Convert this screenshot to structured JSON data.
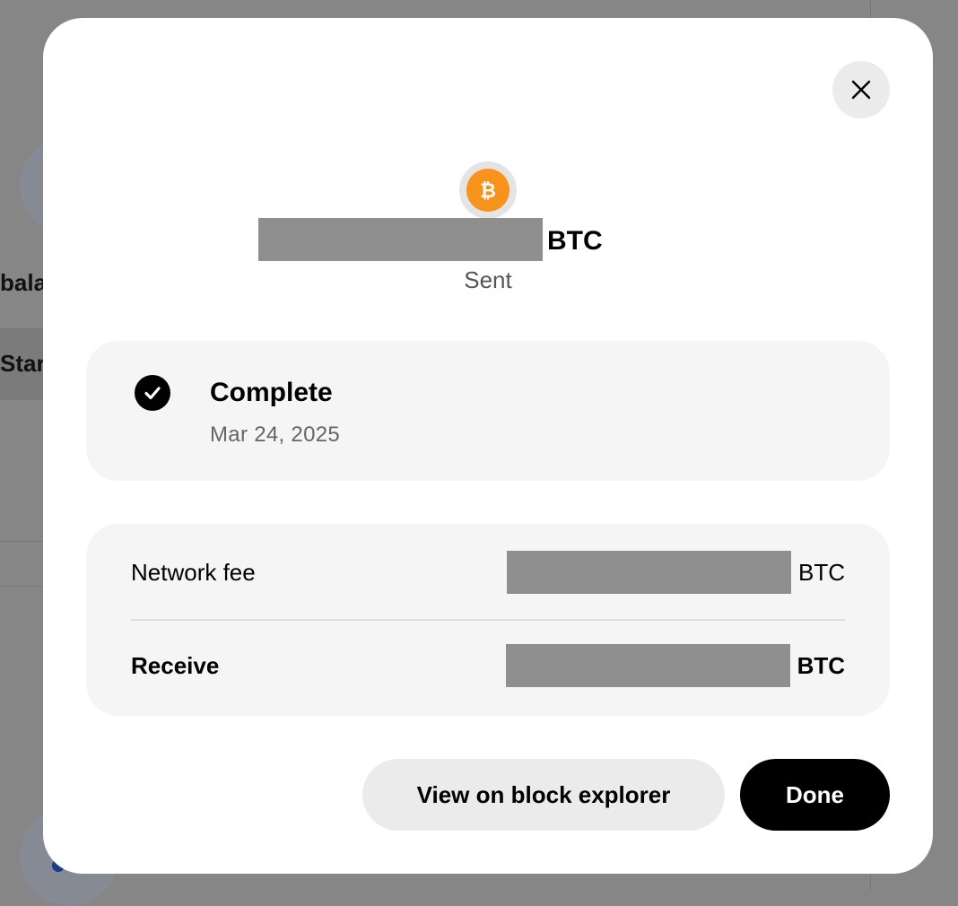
{
  "background": {
    "balance_fragment": "bala",
    "start_fragment": "Star"
  },
  "modal": {
    "close_icon": "close-icon",
    "coin": {
      "symbol": "₿",
      "icon": "bitcoin-icon",
      "color": "#f7931a"
    },
    "amount": {
      "value_redacted": true,
      "unit": "BTC"
    },
    "direction": "Sent",
    "status": {
      "icon": "check-circle-icon",
      "title": "Complete",
      "date": "Mar 24, 2025"
    },
    "details": {
      "network_fee": {
        "label": "Network fee",
        "value_redacted": true,
        "unit": "BTC"
      },
      "receive": {
        "label": "Receive",
        "value_redacted": true,
        "unit": "BTC"
      }
    },
    "actions": {
      "block_explorer_label": "View on block explorer",
      "done_label": "Done"
    }
  }
}
